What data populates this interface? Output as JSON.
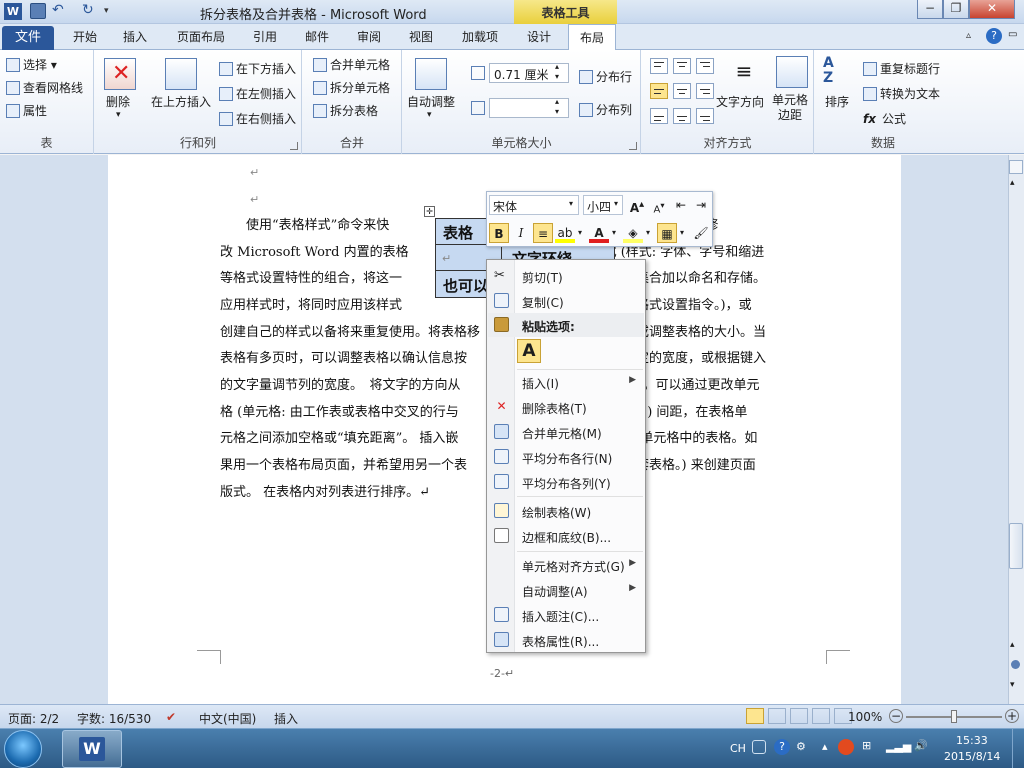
{
  "window": {
    "title": "拆分表格及合并表格 - Microsoft Word",
    "contextual_tab_group": "表格工具",
    "app_icon": "W"
  },
  "tabs": [
    "文件",
    "开始",
    "插入",
    "页面布局",
    "引用",
    "邮件",
    "审阅",
    "视图",
    "加载项",
    "设计",
    "布局"
  ],
  "active_tab": "布局",
  "ribbon": {
    "table_group": {
      "label": "表",
      "select": "选择",
      "gridlines": "查看网格线",
      "properties": "属性"
    },
    "rows_cols_group": {
      "label": "行和列",
      "delete": "删除",
      "insert_above": "在上方插入",
      "insert_below": "在下方插入",
      "insert_left": "在左侧插入",
      "insert_right": "在右侧插入"
    },
    "merge_group": {
      "label": "合并",
      "merge_cells": "合并单元格",
      "split_cells": "拆分单元格",
      "split_table": "拆分表格"
    },
    "cell_size_group": {
      "label": "单元格大小",
      "autofit": "自动调整",
      "height_value": "0.71 厘米",
      "width_value": "",
      "distribute_rows": "分布行",
      "distribute_cols": "分布列"
    },
    "alignment_group": {
      "label": "对齐方式",
      "text_direction": "文字方向",
      "cell_margins": "单元格\n边距"
    },
    "data_group": {
      "label": "数据",
      "sort": "排序",
      "repeat_header": "重复标题行",
      "convert_text": "转换为文本",
      "formula": "公式"
    }
  },
  "document": {
    "para_mark_1": "↵",
    "para_mark_2": "↵",
    "lines": [
      "　　使用“表格样式”命令来快　　　　　　　　　　　　　　　　　的设计。 使用或修",
      "改 Microsoft Word 内置的表格　　　　　　　　　　　　　　样式 (样式: 字体、字号和缩进",
      "等格式设置特性的组合，将这一　　　　　　　　　　　　　　　合作为集合加以命名和存储。",
      "应用样式时，将同时应用该样式　　　　　　　　　　　　　　　所有的格式设置指令。)，或",
      "创建自己的样式以备将来重复使用。将表格移　　　　　　　　　位置，或调整表格的大小。当",
      "表格有多页时，可以调整表格以确认信息按　　　　　　　　　　具有固定的宽度，或根据键入",
      "的文字量调节列的宽度。　将文字的方向从　　　　　　　　　　改为水平。可以通过更改单元",
      "格 (单元格: 由工作表或表格中交叉的行与　　　　　　　　　　输入信息。) 间距，在表格单",
      "元格之间添加空格或“填充距离”。 插入嵌　　　　　　　　　　入到表格单元格中的表格。如",
      "果用一个表格布局页面，并希望用另一个表　　　　　　　　　　一个嵌套表格。) 来创建页面",
      "版式。 在表格内对列表进行排序。↵"
    ],
    "table_cells": [
      "表格",
      "文字环绕",
      "↵",
      "也可以"
    ],
    "page_number": "-2-↵"
  },
  "mini_toolbar": {
    "font": "宋体",
    "size": "小四",
    "bold": "B",
    "italic": "I"
  },
  "context_menu": {
    "cut": "剪切(T)",
    "copy": "复制(C)",
    "paste_header": "粘贴选项:",
    "paste_glyph": "A",
    "insert": "插入(I)",
    "delete_table": "删除表格(T)",
    "merge_cells": "合并单元格(M)",
    "distribute_rows": "平均分布各行(N)",
    "distribute_cols": "平均分布各列(Y)",
    "draw_table": "绘制表格(W)",
    "borders_shading": "边框和底纹(B)...",
    "cell_alignment": "单元格对齐方式(G)",
    "autofit": "自动调整(A)",
    "insert_caption": "插入题注(C)...",
    "table_properties": "表格属性(R)..."
  },
  "status_bar": {
    "page": "页面: 2/2",
    "words": "字数: 16/530",
    "language": "中文(中国)",
    "mode": "插入",
    "zoom": "100%"
  },
  "taskbar": {
    "ime": "CH",
    "time": "15:33",
    "date": "2015/8/14"
  },
  "colors": {
    "file_tab": "#2b579a",
    "context_tab": "#e9cf3c",
    "highlight": "#fde58f"
  }
}
